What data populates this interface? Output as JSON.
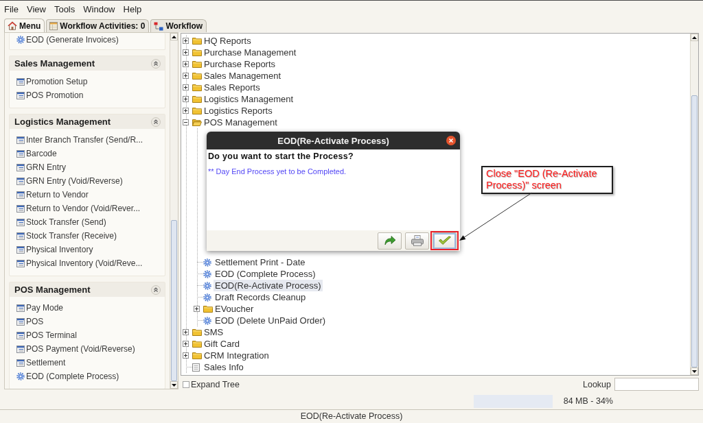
{
  "menu_bar": [
    "File",
    "View",
    "Tools",
    "Window",
    "Help"
  ],
  "tabs": [
    {
      "label": "Menu",
      "kind": "home",
      "selected": true
    },
    {
      "label": "Workflow Activities: 0",
      "kind": "activities",
      "selected": false
    },
    {
      "label": "Workflow",
      "kind": "workflow",
      "selected": false
    }
  ],
  "task_pane": {
    "leading_items": [
      {
        "label": "EOD (Generate Invoices)",
        "kind": "process"
      }
    ],
    "groups": [
      {
        "title": "Sales Management",
        "expanded": true,
        "items": [
          {
            "label": "Promotion Setup",
            "kind": "form"
          },
          {
            "label": "POS Promotion",
            "kind": "form"
          }
        ]
      },
      {
        "title": "Logistics Management",
        "expanded": true,
        "items": [
          {
            "label": "Inter Branch Transfer (Send/R...",
            "kind": "form"
          },
          {
            "label": "Barcode",
            "kind": "form"
          },
          {
            "label": "GRN Entry",
            "kind": "form"
          },
          {
            "label": "GRN Entry (Void/Reverse)",
            "kind": "form"
          },
          {
            "label": "Return to Vendor",
            "kind": "form"
          },
          {
            "label": "Return to Vendor (Void/Rever...",
            "kind": "form"
          },
          {
            "label": "Stock Transfer (Send)",
            "kind": "form"
          },
          {
            "label": "Stock Transfer (Receive)",
            "kind": "form"
          },
          {
            "label": "Physical Inventory",
            "kind": "form"
          },
          {
            "label": "Physical Inventory (Void/Reve...",
            "kind": "form"
          }
        ]
      },
      {
        "title": "POS Management",
        "expanded": true,
        "items": [
          {
            "label": "Pay Mode",
            "kind": "form"
          },
          {
            "label": "POS",
            "kind": "form"
          },
          {
            "label": "POS Terminal",
            "kind": "form"
          },
          {
            "label": "POS Payment (Void/Reverse)",
            "kind": "form"
          },
          {
            "label": "Settlement",
            "kind": "form"
          },
          {
            "label": "EOD (Complete Process)",
            "kind": "process"
          }
        ]
      }
    ]
  },
  "tree": {
    "nodes": [
      {
        "label": "HQ Reports",
        "kind": "folder",
        "expanded": false,
        "selected": false
      },
      {
        "label": "Purchase Management",
        "kind": "folder",
        "expanded": false,
        "selected": false
      },
      {
        "label": "Purchase Reports",
        "kind": "folder",
        "expanded": false,
        "selected": false
      },
      {
        "label": "Sales Management",
        "kind": "folder",
        "expanded": false,
        "selected": false
      },
      {
        "label": "Sales Reports",
        "kind": "folder",
        "expanded": false,
        "selected": false
      },
      {
        "label": "Logistics Management",
        "kind": "folder",
        "expanded": false,
        "selected": false
      },
      {
        "label": "Logistics Reports",
        "kind": "folder",
        "expanded": false,
        "selected": false
      },
      {
        "label": "POS Management",
        "kind": "folder",
        "expanded": true,
        "selected": false,
        "children": [
          {
            "label": "Settlement Print - Date",
            "kind": "process",
            "selected": false
          },
          {
            "label": "EOD (Complete Process)",
            "kind": "process",
            "selected": false
          },
          {
            "label": "EOD(Re-Activate Process)",
            "kind": "process",
            "selected": true
          },
          {
            "label": "Draft Records Cleanup",
            "kind": "process",
            "selected": false
          },
          {
            "label": "EVoucher",
            "kind": "folder",
            "expanded": false,
            "selected": false
          },
          {
            "label": "EOD (Delete UnPaid Order)",
            "kind": "process",
            "selected": false
          }
        ]
      },
      {
        "label": "SMS",
        "kind": "folder",
        "expanded": false,
        "selected": false
      },
      {
        "label": "Gift Card",
        "kind": "folder",
        "expanded": false,
        "selected": false
      },
      {
        "label": "CRM Integration",
        "kind": "folder",
        "expanded": false,
        "selected": false
      },
      {
        "label": "Sales Info",
        "kind": "document",
        "selected": false
      }
    ]
  },
  "dialog": {
    "title": "EOD(Re-Activate Process)",
    "message": "Do you want to start the Process?",
    "note": "** Day End Process yet to be Completed.",
    "buttons": [
      {
        "kind": "redo",
        "focused": false
      },
      {
        "kind": "print",
        "focused": false
      },
      {
        "kind": "ok",
        "focused": true
      }
    ]
  },
  "annotation": {
    "text": "Close \"EOD (Re-Activate Process)\" screen"
  },
  "expand_tree": {
    "label": "Expand Tree",
    "checked": false
  },
  "lookup": {
    "label": "Lookup"
  },
  "memory": {
    "text": "84 MB - 34%"
  },
  "status_bar": {
    "text": "EOD(Re-Activate Process)"
  }
}
